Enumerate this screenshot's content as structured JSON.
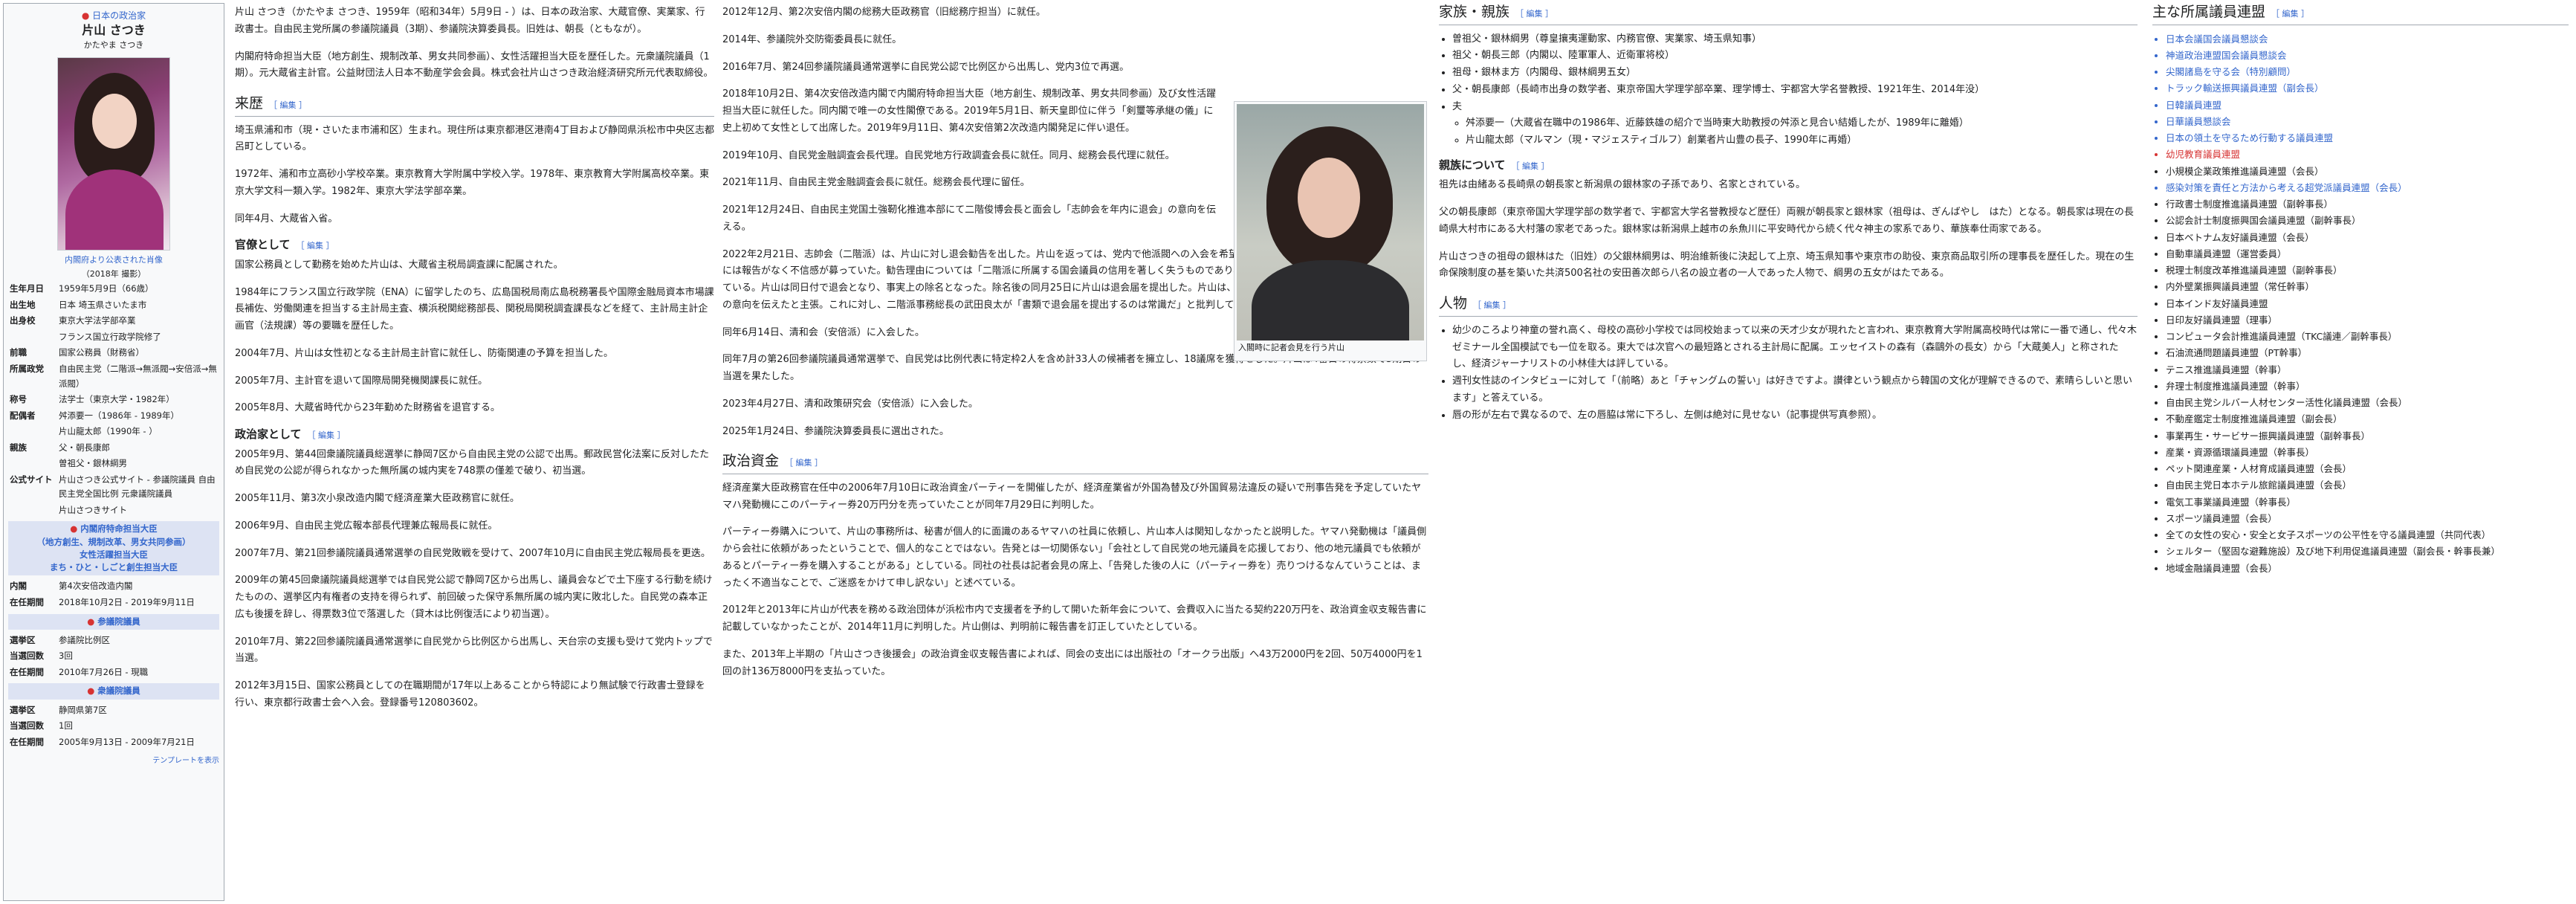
{
  "infobox": {
    "party": "日本の政治家",
    "name": "片山 さつき",
    "reading": "かたやま さつき",
    "photo_caption": "内閣府より公表された肖像",
    "photo_year": "（2018年 撮影）",
    "rows": [
      {
        "k": "生年月日",
        "v": "1959年5月9日（66歳）"
      },
      {
        "k": "出生地",
        "v": "日本 埼玉県さいたま市"
      },
      {
        "k": "出身校",
        "v": "東京大学法学部卒業"
      },
      {
        "k": "",
        "v": "フランス国立行政学院修了"
      },
      {
        "k": "前職",
        "v": "国家公務員（財務省）"
      },
      {
        "k": "所属政党",
        "v": "自由民主党（二階派→無派閥→安倍派→無派閥）"
      },
      {
        "k": "称号",
        "v": "法学士（東京大学・1982年）"
      },
      {
        "k": "配偶者",
        "v": "舛添要一（1986年 - 1989年）"
      },
      {
        "k": "",
        "v": "片山龍太郎（1990年 - ）"
      },
      {
        "k": "親族",
        "v": "父・朝長康郎"
      },
      {
        "k": "",
        "v": "曽祖父・銀林綱男"
      },
      {
        "k": "公式サイト",
        "v": "片山さつき公式サイト - 参議院議員 自由民主党全国比例 元衆議院議員"
      },
      {
        "k": "",
        "v": "片山さつきサイト"
      }
    ],
    "band1": [
      "内閣府特命担当大臣",
      "（地方創生、規制改革、男女共同参画）",
      "女性活躍担当大臣",
      "まち・ひと・しごと創生担当大臣"
    ],
    "band1_rows": [
      {
        "k": "内閣",
        "v": "第4次安倍改造内閣"
      },
      {
        "k": "在任期間",
        "v": "2018年10月2日 - 2019年9月11日"
      }
    ],
    "band2": "参議院議員",
    "band2_rows": [
      {
        "k": "選挙区",
        "v": "参議院比例区"
      },
      {
        "k": "当選回数",
        "v": "3回"
      },
      {
        "k": "在任期間",
        "v": "2010年7月26日 - 現職"
      }
    ],
    "band3": "衆議院議員",
    "band3_rows": [
      {
        "k": "選挙区",
        "v": "静岡県第7区"
      },
      {
        "k": "当選回数",
        "v": "1回"
      },
      {
        "k": "在任期間",
        "v": "2005年9月13日 - 2009年7月21日"
      }
    ],
    "footer": "テンプレートを表示"
  },
  "col1": {
    "lead": "片山 さつき（かたやま さつき、1959年（昭和34年）5月9日 - ）は、日本の政治家、大蔵官僚、実業家、行政書士。自由民主党所属の参議院議員（3期）、参議院決算委員長。旧姓は、朝長（ともなが）。",
    "lead2": "内閣府特命担当大臣（地方創生、規制改革、男女共同参画）、女性活躍担当大臣を歴任した。元衆議院議員（1期）。元大蔵省主計官。公益財団法人日本不動産学会会員。株式会社片山さつき政治経済研究所元代表取締役。",
    "h_career": "来歴",
    "career1": "埼玉県浦和市（現・さいたま市浦和区）生まれ。現住所は東京都港区港南4丁目および静岡県浜松市中央区志都呂町としている。",
    "career2": "1972年、浦和市立高砂小学校卒業。東京教育大学附属中学校入学。1978年、東京教育大学附属高校卒業。東京大学文科一類入学。1982年、東京大学法学部卒業。",
    "career3": "同年4月、大蔵省入省。",
    "h_kanryo": "官僚として",
    "k1": "国家公務員として勤務を始めた片山は、大蔵省主税局調査課に配属された。",
    "k2": "1984年にフランス国立行政学院（ENA）に留学したのち、広島国税局南広島税務署長や国際金融局資本市場課長補佐、労働関連を担当する主計局主査、横浜税関総務部長、関税局関税調査課長などを経て、主計局主計企画官（法規課）等の要職を歴任した。",
    "k3": "2004年7月、片山は女性初となる主計局主計官に就任し、防衛関連の予算を担当した。",
    "k4": "2005年7月、主計官を退いて国際局開発機関課長に就任。",
    "k5": "2005年8月、大蔵省時代から23年勤めた財務省を退官する。",
    "h_seiji": "政治家として",
    "s1": "2005年9月、第44回衆議院議員総選挙に静岡7区から自由民主党の公認で出馬。郵政民営化法案に反対したため自民党の公認が得られなかった無所属の城内実を748票の僅差で破り、初当選。",
    "s2": "2005年11月、第3次小泉改造内閣で経済産業大臣政務官に就任。",
    "s3": "2006年9月、自由民主党広報本部長代理兼広報局長に就任。",
    "s4": "2007年7月、第21回参議院議員通常選挙の自民党敗戦を受けて、2007年10月に自由民主党広報局長を更迭。",
    "s5": "2009年の第45回衆議院議員総選挙では自民党公認で静岡7区から出馬し、議員会などで土下座する行動を続けたものの、選挙区内有権者の支持を得られず、前回破った保守系無所属の城内実に敗北した。自民党の森本正広も後援を辞し、得票数3位で落選した（貸木は比例復活により初当選）。",
    "s6": "2010年7月、第22回参議院議員通常選挙に自民党から比例区から出馬し、天台宗の支援も受けて党内トップで当選。",
    "s7": "2012年3月15日、国家公務員としての在職期間が17年以上あることから特認により無試験で行政書士登録を行い、東京都行政書士会へ入会。登録番号120803602。"
  },
  "col2": {
    "p1": "2012年12月、第2次安倍内閣の総務大臣政務官（旧総務庁担当）に就任。",
    "p2": "2014年、参議院外交防衛委員長に就任。",
    "p3": "2016年7月、第24回参議院議員通常選挙に自民党公認で比例区から出馬し、党内3位で再選。",
    "p4": "2018年10月2日、第4次安倍改造内閣で内閣府特命担当大臣（地方創生、規制改革、男女共同参画）及び女性活躍担当大臣に就任した。同内閣で唯一の女性閣僚である。2019年5月1日、新天皇即位に伴う「剣璽等承継の儀」に史上初めて女性として出席した。2019年9月11日、第4次安倍第2次改造内閣発足に伴い退任。",
    "p5": "2019年10月、自民党金融調査会長代理。自民党地方行政調査会長に就任。同月、総務会長代理に就任。",
    "p6": "2021年11月、自由民主党金融調査会長に就任。総務会長代理に留任。",
    "p7": "2021年12月24日、自由民主党国土強靭化推進本部にて二階俊博会長と面会し「志帥会を年内に退会」の意向を伝える。",
    "p8": "2022年2月21日、志帥会（二階派）は、片山に対し退会勧告を出した。片山を返っては、党内で他派閥への入会を希望しているとの観測が流れていたが、二階派には報告がなく不信感が募っていた。勧告理由については「二階派に所属する国会議員の信用を著しく失うものであり、かつ同会趣旨に反を行為も見られる」としている。片山は同日付で退会となり、事実上の除名となった。除名後の同月25日に片山は退会届を提出した。片山は、会長の二階俊博に2021年の末に口頭で退会の意向を伝えたと主張。これに対し、二階派事務総長の武田良太が「書類で退会届を提出するのは常識だ」と批判していた。",
    "p9": "同年6月14日、清和会（安倍派）に入会した。",
    "p10": "同年7月の第26回参議院議員通常選挙で、自民党は比例代表に特定枠2人を含め計33人の候補者を擁立し、18議席を獲得をした。片山は4番目の得票数で3期目の当選を果たした。",
    "p11": "2023年4月27日、清和政策研究会（安倍派）に入会した。",
    "p12": "2025年1月24日、参議院決算委員長に選出された。",
    "photo_caption": "入閣時に記者会見を行う片山",
    "h_money": "政治資金",
    "m1": "経済産業大臣政務官在任中の2006年7月10日に政治資金パーティーを開催したが、経済産業省が外国為替及び外国貿易法違反の疑いで刑事告発を予定していたヤマハ発動機にこのパーティー券20万円分を売っていたことが同年7月29日に判明した。",
    "m2": "パーティー券購入について、片山の事務所は、秘書が個人的に面識のあるヤマハの社員に依頼し、片山本人は関知しなかったと説明した。ヤマハ発動機は「議員側から会社に依頼があったということで、個人的なことではない。告発とは一切関係ない」「会社として自民党の地元議員を応援しており、他の地元議員でも依頼があるとパーティー券を購入することがある」としている。同社の社長は記者会見の席上、「告発した後の人に（パーティー券を）売りつけるなんていうことは、まったく不適当なことで、ご迷惑をかけて申し訳ない」と述べている。",
    "m3": "2012年と2013年に片山が代表を務める政治団体が浜松市内で支援者を予約して開いた新年会について、会費収入に当たる契約220万円を、政治資金収支報告書に記載していなかったことが、2014年11月に判明した。片山側は、判明前に報告書を訂正していたとしている。",
    "m4": "また、2013年上半期の「片山さつき後援会」の政治資金収支報告書によれば、同会の支出には出版社の「オークラ出版」へ43万2000円を2回、50万4000円を1回の計136万8000円を支払っていた。"
  },
  "col3": {
    "h_family": "家族・親族",
    "f1": "曽祖父・銀林綱男（尊皇攘夷運動家、内務官僚、実業家、埼玉県知事）",
    "f2": "祖父・朝長三郎（内閣以、陸軍軍人、近衛軍将校）",
    "f3": "祖母・銀林ま方（内閣母、銀林綱男五女）",
    "f4": "父・朝長康郎（長崎市出身の数学者、東京帝国大学理学部卒業、理学博士、宇都宮大学名誉教授、1921年生、2014年没）",
    "f5": "夫",
    "f6": "舛添要一（大蔵省在職中の1986年、近藤鉄雄の紹介で当時東大助教授の舛添と見合い結婚したが、1989年に離婚）",
    "f7": "片山龍太郎（マルマン（現・マジェスティゴルフ）創業者片山豊の長子、1990年に再婚）",
    "h_oya": "親族について",
    "o1": "祖先は由緒ある長崎県の朝長家と新潟県の銀林家の子孫であり、名家とされている。",
    "o2": "父の朝長康郎（東京帝国大学理学部の数学者で、宇都宮大学名誉教授など歴任）両親が朝長家と銀林家（祖母は、ぎんばやし　はた）となる。朝長家は現在の長崎県大村市にある大村藩の家老であった。銀林家は新潟県上越市の糸魚川に平安時代から続く代々神主の家系であり、華族奉仕両家である。",
    "o3": "片山さつきの祖母の銀林はた（旧姓）の父銀林綱男は、明治維新後に決起して上京、埼玉県知事や東京市の助役、東京商品取引所の理事長を歴任した。現在の生命保険制度の基を築いた共済500名社の安田善次郎ら八名の設立者の一人であった人物で、綱男の五女がはたである。",
    "h_person": "人物",
    "pe1": "幼少のころより神童の誉れ高く、母校の高砂小学校では同校始まって以来の天才少女が現れたと言われ、東京教育大学附属高校時代は常に一番で通し、代々木ゼミナール全国模試でも一位を取る。東大では次官への最短路とされる主計局に配属。エッセイストの森有（森鷗外の長女）から「大蔵美人」と称されたし、経済ジャーナリストの小林佳大は評している。",
    "pe2": "週刊女性誌のインタビューに対して「（前略）あと「チャングムの誓い」は好きですよ。讃律という観点から韓国の文化が理解できるので、素晴らしいと思います」と答えている。",
    "pe3": "唇の形が左右で異なるので、左の唇脇は常に下ろし、左側は絶対に見せない（記事提供写真参照）。"
  },
  "col4": {
    "h_giren": "主な所属議員連盟",
    "items": [
      {
        "t": "日本会議国会議員懇談会",
        "c": "link"
      },
      {
        "t": "神道政治連盟国会議員懇談会",
        "c": "link"
      },
      {
        "t": "尖閣諸島を守る会（特別顧問）",
        "c": "link"
      },
      {
        "t": "トラック輸送振興議員連盟（副会長）",
        "c": "link"
      },
      {
        "t": "日韓議員連盟",
        "c": "link"
      },
      {
        "t": "日華議員懇談会",
        "c": "link"
      },
      {
        "t": "日本の領土を守るため行動する議員連盟",
        "c": "link"
      },
      {
        "t": "幼児教育議員連盟",
        "c": "red"
      },
      {
        "t": "小規模企業政策推進議員連盟（会長）",
        "c": ""
      },
      {
        "t": "感染対策を責任と方法から考える超党派議員連盟（会長）",
        "c": "link"
      },
      {
        "t": "行政書士制度推進議員連盟（副幹事長）",
        "c": ""
      },
      {
        "t": "公認会計士制度振興国会議員連盟（副幹事長）",
        "c": ""
      },
      {
        "t": "日本ベトナム友好議員連盟（会長）",
        "c": ""
      },
      {
        "t": "自動車議員連盟（運営委員）",
        "c": ""
      },
      {
        "t": "税理士制度改革推進議員連盟（副幹事長）",
        "c": ""
      },
      {
        "t": "内外壁業振興議員連盟（常任幹事）",
        "c": ""
      },
      {
        "t": "日本インド友好議員連盟",
        "c": ""
      },
      {
        "t": "日印友好議員連盟（理事）",
        "c": ""
      },
      {
        "t": "コンピュータ会計推進議員連盟（TKC議連／副幹事長）",
        "c": ""
      },
      {
        "t": "石油流通問題議員連盟（PT幹事）",
        "c": ""
      },
      {
        "t": "テニス推進議員連盟（幹事）",
        "c": ""
      },
      {
        "t": "弁理士制度推進議員連盟（幹事）",
        "c": ""
      },
      {
        "t": "自由民主党シルバー人材センター活性化議員連盟（会長）",
        "c": ""
      },
      {
        "t": "不動産鑑定士制度推進議員連盟（副会長）",
        "c": ""
      },
      {
        "t": "事業再生・サービサー振興議員連盟（副幹事長）",
        "c": ""
      },
      {
        "t": "産業・資源循環議員連盟（幹事長）",
        "c": ""
      },
      {
        "t": "ペット関連産業・人材育成議員連盟（会長）",
        "c": ""
      },
      {
        "t": "自由民主党日本ホテル旅館議員連盟（会長）",
        "c": ""
      },
      {
        "t": "電気工事業議員連盟（幹事長）",
        "c": ""
      },
      {
        "t": "スポーツ議員連盟（会長）",
        "c": ""
      },
      {
        "t": "全ての女性の安心・安全と女子スポーツの公平性を守る議員連盟（共同代表）",
        "c": ""
      },
      {
        "t": "シェルター（堅固な避難施設）及び地下利用促進議員連盟（副会長・幹事長兼）",
        "c": ""
      },
      {
        "t": "地域金融議員連盟（会長）",
        "c": ""
      }
    ]
  },
  "edit_label": "［ 編集 ］"
}
